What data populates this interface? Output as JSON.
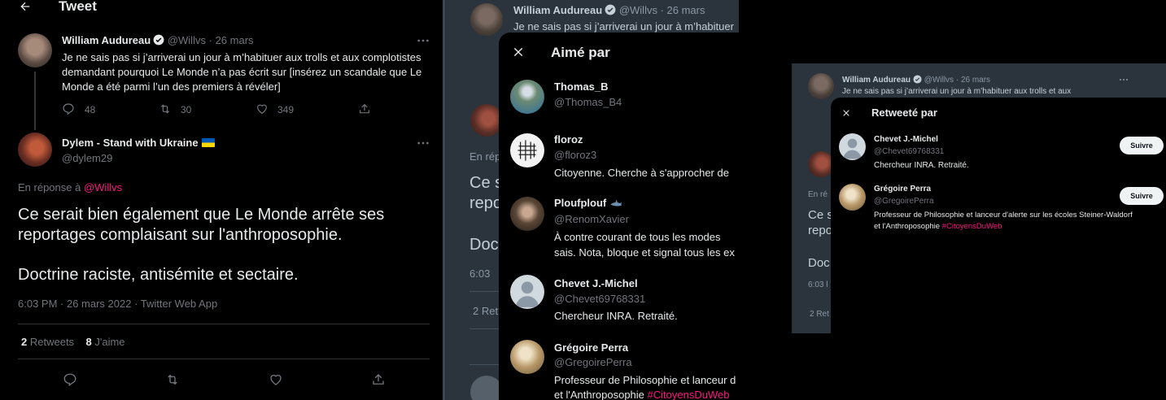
{
  "left": {
    "header_title": "Tweet",
    "parent": {
      "name": "William Audureau",
      "handle": "@Willvs",
      "sep": "·",
      "date": "26 mars",
      "text": "Je ne sais pas si j’arriverai un jour à m’habituer aux trolls et aux complotistes demandant pourquoi Le Monde n’a pas écrit sur [insérez un scandale que Le Monde a été parmi l’un des premiers à révéler]",
      "replies": "48",
      "retweets": "30",
      "likes": "349"
    },
    "reply": {
      "name": "Dylem - Stand with Ukraine",
      "handle": "@dylem29",
      "reply_prefix": "En réponse à",
      "reply_to": "@Willvs",
      "text_line1": "Ce serait bien également que Le Monde arrête ses reportages complaisant sur l'anthroposophie.",
      "text_line2": "Doctrine raciste, antisémite et sectaire.",
      "meta": "6:03 PM · 26 mars 2022 · Twitter Web App",
      "retweets_count": "2",
      "retweets_label": "Retweets",
      "likes_count": "8",
      "likes_label": "J'aime"
    }
  },
  "liked_modal": {
    "bg_header_name": "William Audureau",
    "bg_header_handle": "@Willvs",
    "bg_header_date": "26 mars",
    "bg_header_text": "Je ne sais pas si j’arriverai un jour à m’habituer",
    "bg_reply_prefix": "En rép",
    "bg_text1": "Ce s",
    "bg_text2": "repo",
    "bg_text3": "Doc",
    "bg_meta": "6:03",
    "bg_stats": "2 Ret",
    "title": "Aimé par",
    "users": [
      {
        "name": "Thomas_B",
        "handle": "@Thomas_B4",
        "bio": ""
      },
      {
        "name": "floroz",
        "handle": "@floroz3",
        "bio": "Citoyenne. Cherche à s'approcher de"
      },
      {
        "name": "Ploufplouf",
        "handle": "@RenomXavier",
        "bio": "À contre courant de tous les modes",
        "bio2": "sais. Nota, bloque et signal tous les ex"
      },
      {
        "name": "Chevet J.-Michel",
        "handle": "@Chevet69768331",
        "bio": "Chercheur INRA. Retraité."
      },
      {
        "name": "Grégoire Perra",
        "handle": "@GregoirePerra",
        "bio": "Professeur de Philosophie et lanceur d",
        "bio2": "et l'Anthroposophie",
        "tag": "#CitoyensDuWeb"
      }
    ]
  },
  "rt_modal": {
    "bg_header_name": "William Audureau",
    "bg_header_handle": "@Willvs",
    "bg_header_date": "26 mars",
    "bg_header_text": "Je ne sais pas si j’arriverai un jour à m’habituer aux trolls et aux",
    "bg_reply_prefix": "En ré",
    "bg_text1": "Ce s",
    "bg_text2": "repo",
    "bg_text3": "Doc",
    "bg_meta": "6:03 l",
    "bg_stats": "2 Ret",
    "title": "Retweeté par",
    "follow_label": "Suivre",
    "users": [
      {
        "name": "Chevet J.-Michel",
        "handle": "@Chevet69768331",
        "bio": "Chercheur INRA. Retraité."
      },
      {
        "name": "Grégoire Perra",
        "handle": "@GregoirePerra",
        "bio": "Professeur de Philosophie et lanceur d'alerte sur les écoles Steiner-Waldorf",
        "bio2": "et l'Anthroposophie",
        "tag": "#CitoyensDuWeb"
      }
    ]
  },
  "colors": {
    "background": "#000000",
    "accent_pink": "#f91880",
    "muted": "#71767b",
    "dim_overlay": "#5b7083"
  }
}
